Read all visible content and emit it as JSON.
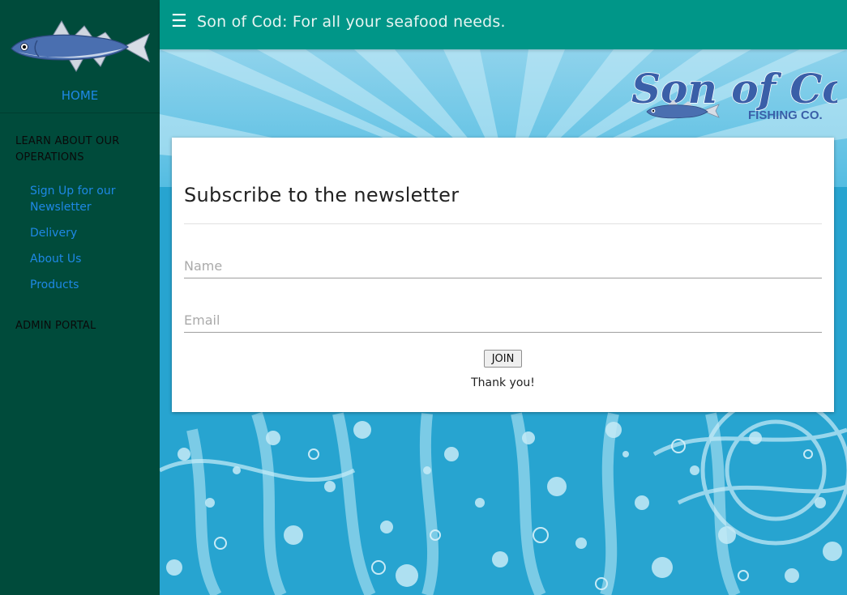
{
  "app": {
    "title": "Son of Cod: For all your seafood needs."
  },
  "sidebar": {
    "home_label": "HOME",
    "sections": [
      {
        "heading": "LEARN ABOUT OUR OPERATIONS",
        "items": [
          {
            "label": "Sign Up for our Newsletter"
          },
          {
            "label": "Delivery"
          },
          {
            "label": "About Us"
          },
          {
            "label": "Products"
          }
        ]
      },
      {
        "heading": "ADMIN PORTAL",
        "items": []
      }
    ]
  },
  "brand": {
    "name_line1": "Son of Cod",
    "name_line2": "FISHING CO."
  },
  "newsletter": {
    "heading": "Subscribe to the newsletter",
    "name_placeholder": "Name",
    "name_value": "",
    "email_placeholder": "Email",
    "email_value": "",
    "join_label": "JOIN",
    "status_text": "Thank you!"
  },
  "icons": {
    "menu": "hamburger-menu-icon",
    "logo": "fish-logo-icon"
  },
  "colors": {
    "sidebar_bg": "#004b3b",
    "header_bg": "#009688",
    "link": "#1e88e5",
    "water": "#29a9d4",
    "brand_text": "#3a5fa8"
  }
}
